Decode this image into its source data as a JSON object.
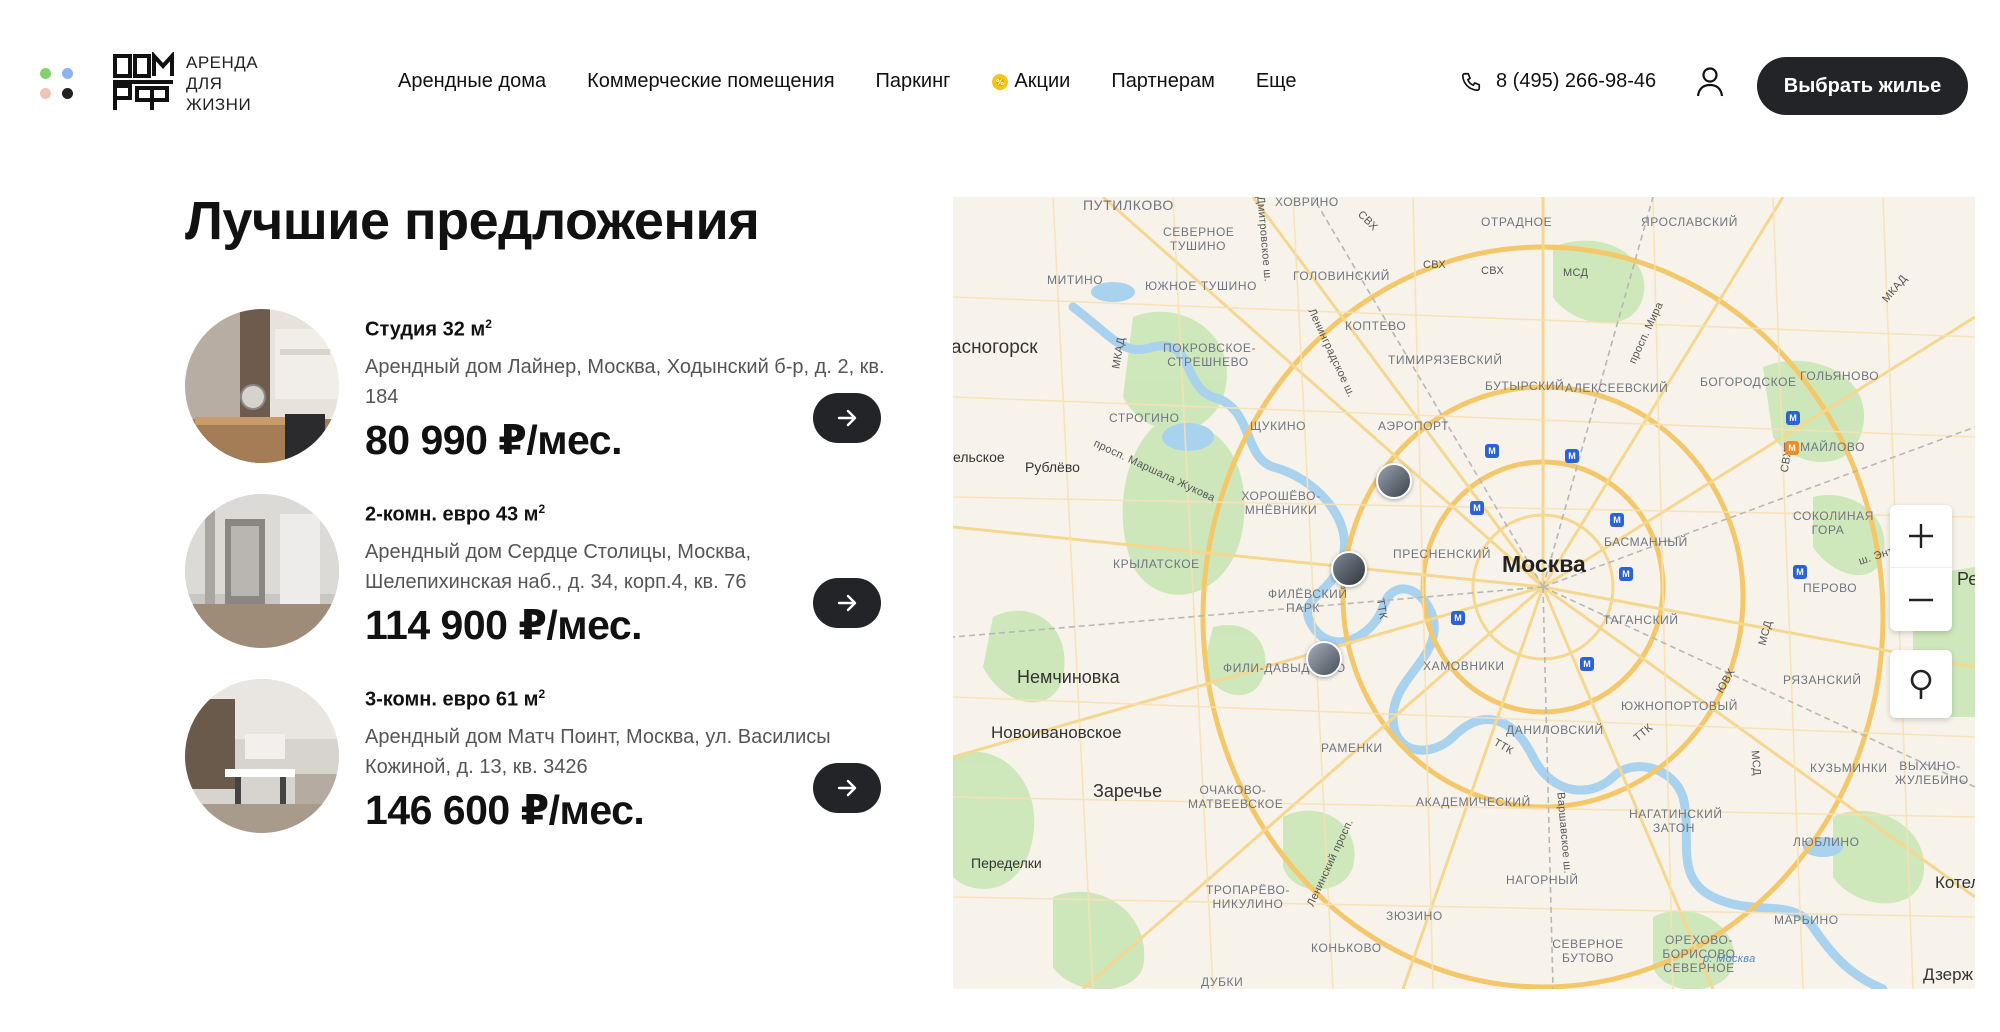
{
  "brand": {
    "logo_text": [
      "АРЕНДА",
      "ДЛЯ",
      "ЖИЗНИ"
    ],
    "dot_colors": [
      "#86d16f",
      "#8fb1f2",
      "#f0c4b4",
      "#222222"
    ]
  },
  "nav": {
    "items": [
      "Арендные дома",
      "Коммерческие помещения",
      "Паркинг",
      "Акции",
      "Партнерам",
      "Еще"
    ]
  },
  "header": {
    "phone": "8 (495) 266-98-46",
    "cta_label": "Выбрать жилье"
  },
  "offers": {
    "title": "Лучшие предложения",
    "items": [
      {
        "type": "Студия 32 м",
        "sup": "2",
        "address": "Арендный дом Лайнер, Москва, Ходынский б-р, д. 2, кв. 184",
        "price": "80 990 ₽/мес."
      },
      {
        "type": "2-комн. евро 43 м",
        "sup": "2",
        "address": "Арендный дом Сердце Столицы, Москва, Шелепихинская наб., д. 34, корп.4, кв. 76",
        "price": "114 900 ₽/мес."
      },
      {
        "type": "3-комн. евро 61 м",
        "sup": "2",
        "address": "Арендный дом Матч Поинт, Москва, ул. Василисы Кожиной, д. 13, кв. 3426",
        "price": "146 600 ₽/мес."
      }
    ]
  },
  "map": {
    "capital": "Москва",
    "cities": [
      "асногорск",
      "Рублёво",
      "Немчиновка",
      "Новоивановское",
      "Заречье",
      "Переделки",
      "Котел",
      "Дзерж",
      "ельское",
      "Ре"
    ],
    "districts": [
      "Путилково",
      "Ховрино",
      "Отрадное",
      "Ярославский",
      "Северное Тушино",
      "Митино",
      "Южное Тушино",
      "Головинский",
      "Коптево",
      "Покровское-Стрешнево",
      "Тимирязевский",
      "Бутырский",
      "Алексеевский",
      "Богородское",
      "Гольяново",
      "Строгино",
      "Щукино",
      "Аэропорт",
      "Измайлово",
      "Хорошёво-Мнёвники",
      "Соколиная гора",
      "Пресненский",
      "Басманный",
      "Крылатское",
      "Филёвский парк",
      "Перово",
      "Таганский",
      "Фили-Давыдково",
      "Хамовники",
      "Рязанский",
      "Даниловский",
      "Южнопортовый",
      "Раменки",
      "Очаково-Матвеевское",
      "Академический",
      "Кузьминки",
      "Выхино-Жулебино",
      "Нагатинский Затон",
      "Люблино",
      "Тропарёво-Никулино",
      "Нагорный",
      "Зюзино",
      "Марьино",
      "Коньково",
      "Северное Бутово",
      "Орехово-Борисово Северное",
      "Дубки"
    ],
    "roads": [
      "СВХ",
      "СВХ",
      "СВХ",
      "МСД",
      "МКАД",
      "МКАД",
      "Ленинградское ш.",
      "просп. Мира",
      "Дмитровское ш.",
      "просп. Маршала Жукова",
      "ТТК",
      "ТТК",
      "ТТК",
      "ш. Энтузиастов",
      "СВХ",
      "ЮВХ",
      "МСД",
      "МСД",
      "Варшавское ш.",
      "Ленинский просп.",
      "р. Москва"
    ],
    "zoom_in": "+",
    "zoom_out": "−"
  }
}
